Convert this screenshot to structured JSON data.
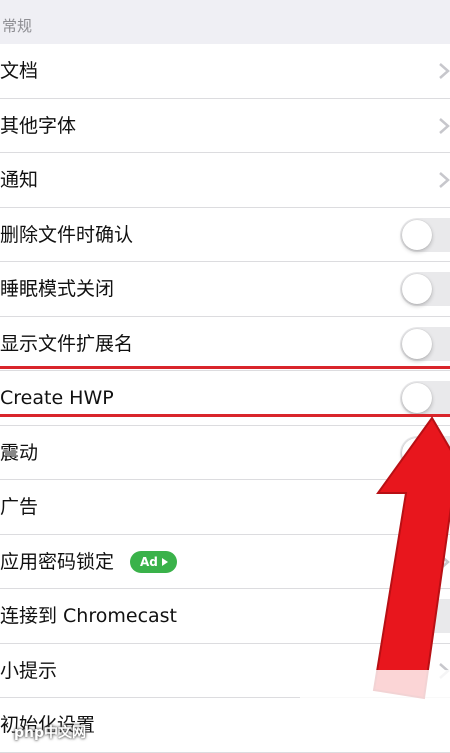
{
  "section_header": "常规",
  "rows": [
    {
      "label": "文档",
      "control": "chevron"
    },
    {
      "label": "其他字体",
      "control": "chevron"
    },
    {
      "label": "通知",
      "control": "chevron"
    },
    {
      "label": "删除文件时确认",
      "control": "toggle",
      "on": false
    },
    {
      "label": "睡眠模式关闭",
      "control": "toggle",
      "on": false
    },
    {
      "label": "显示文件扩展名",
      "control": "toggle",
      "on": false
    },
    {
      "label": "Create HWP",
      "control": "toggle",
      "on": false
    },
    {
      "label": "震动",
      "control": "toggle",
      "on": false
    },
    {
      "label": "广告",
      "control": "none"
    },
    {
      "label": "应用密码锁定",
      "control": "chevron",
      "badge": "Ad"
    },
    {
      "label": "连接到 Chromecast",
      "control": "toggle",
      "on": false
    },
    {
      "label": "小提示",
      "control": "chevron"
    },
    {
      "label": "初始化设置",
      "control": "none"
    }
  ],
  "watermark": "php中文网",
  "colors": {
    "background": "#efeff4",
    "highlight": "#d9252b",
    "badge": "#3ab24a",
    "toggle_off": "#e9e9eb",
    "chevron": "#c7c7cc"
  }
}
